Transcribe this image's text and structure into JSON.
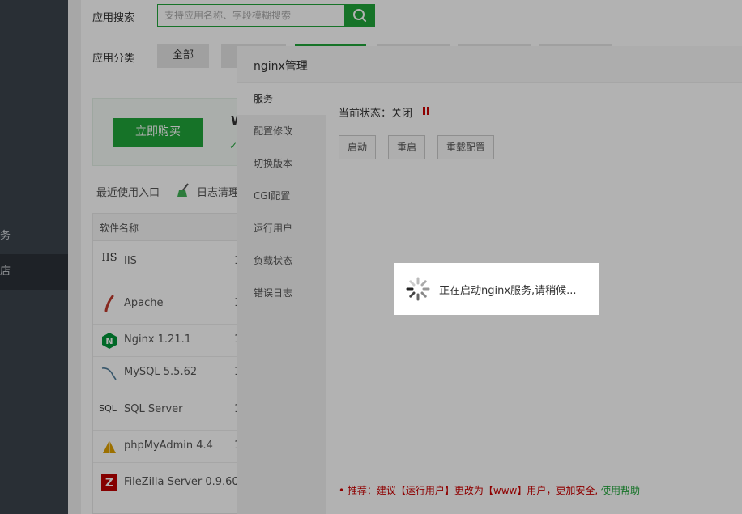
{
  "sidebar": {
    "items": [
      {
        "label": "服务"
      },
      {
        "label": "商店"
      }
    ]
  },
  "search": {
    "label": "应用搜索",
    "placeholder": "支持应用名称、字段模糊搜索"
  },
  "category": {
    "label": "应用分类",
    "active": "全部"
  },
  "promo": {
    "buy_label": "立即购买",
    "char": "W"
  },
  "quick": {
    "recent": "最近使用入口",
    "logclean": "日志清理"
  },
  "table": {
    "header_name": "软件名称",
    "rows": [
      {
        "icon": "iis-icon",
        "name": "IIS"
      },
      {
        "icon": "apache-feather-icon",
        "name": "Apache"
      },
      {
        "icon": "nginx-icon",
        "name": "Nginx 1.21.1"
      },
      {
        "icon": "mysql-dolphin-icon",
        "name": "MySQL 5.5.62"
      },
      {
        "icon": "sql-server-icon",
        "name": "SQL Server"
      },
      {
        "icon": "phpmyadmin-icon",
        "name": "phpMyAdmin 4.4"
      },
      {
        "icon": "filezilla-icon",
        "name": "FileZilla Server 0.9.60"
      }
    ]
  },
  "modal": {
    "title": "nginx管理",
    "nav": [
      "服务",
      "配置修改",
      "切换版本",
      "CGI配置",
      "运行用户",
      "负载状态",
      "错误日志"
    ],
    "status_label": "当前状态：关闭",
    "buttons": {
      "start": "启动",
      "restart": "重启",
      "reload": "重载配置"
    },
    "tip_prefix": "• 推荐：建议【运行用户】更改为【www】用户，更加安全,",
    "tip_link": "使用帮助"
  },
  "toast": {
    "text": "正在启动nginx服务,请稍候..."
  },
  "colors": {
    "brand": "#20a53a",
    "danger": "#cc0000",
    "sidebar": "#3c444d"
  }
}
